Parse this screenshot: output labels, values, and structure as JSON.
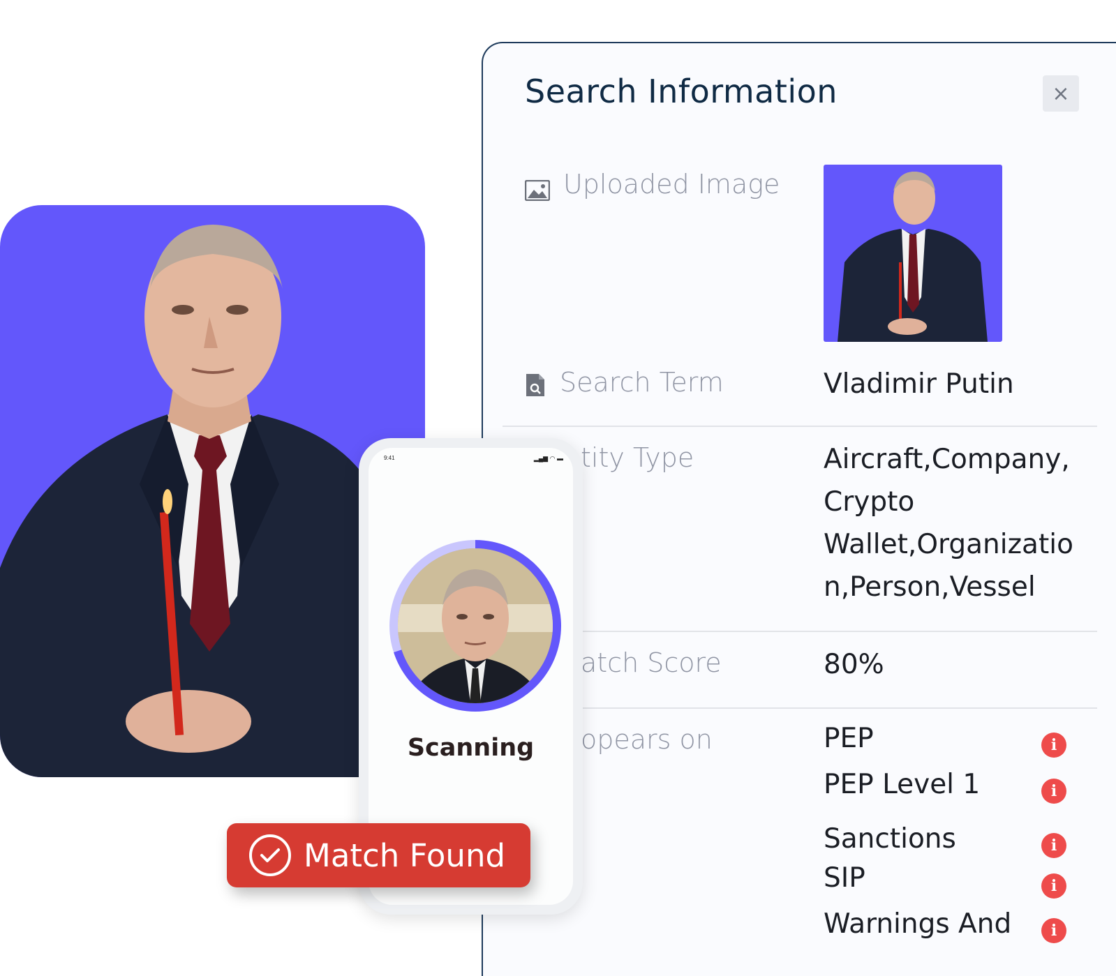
{
  "panel": {
    "title": "Search Information",
    "close_label": "×",
    "rows": {
      "uploaded_image_label": "Uploaded Image",
      "search_term_label": "Search Term",
      "search_term_value": "Vladimir Putin",
      "entity_type_label": "tity Type",
      "entity_type_lines": [
        "Aircraft,Company,",
        "Crypto",
        "Wallet,Organizatio",
        "n,Person,Vessel"
      ],
      "match_score_label": "atch Score",
      "match_score_value": "80%",
      "appears_on_label": "opears on",
      "appears_on_items": [
        "PEP",
        "PEP Level 1",
        "Sanctions",
        "SIP",
        "Warnings And"
      ]
    },
    "info_icon_glyph": "i"
  },
  "phone": {
    "status_time": "9:41",
    "scan_label": "Scanning",
    "scan_progress": 0.7
  },
  "match": {
    "label": "Match Found"
  },
  "colors": {
    "brand_purple": "#6357fb",
    "alert_red": "#d63b32",
    "info_red": "#ee4b4b",
    "title_navy": "#0f2a44"
  }
}
